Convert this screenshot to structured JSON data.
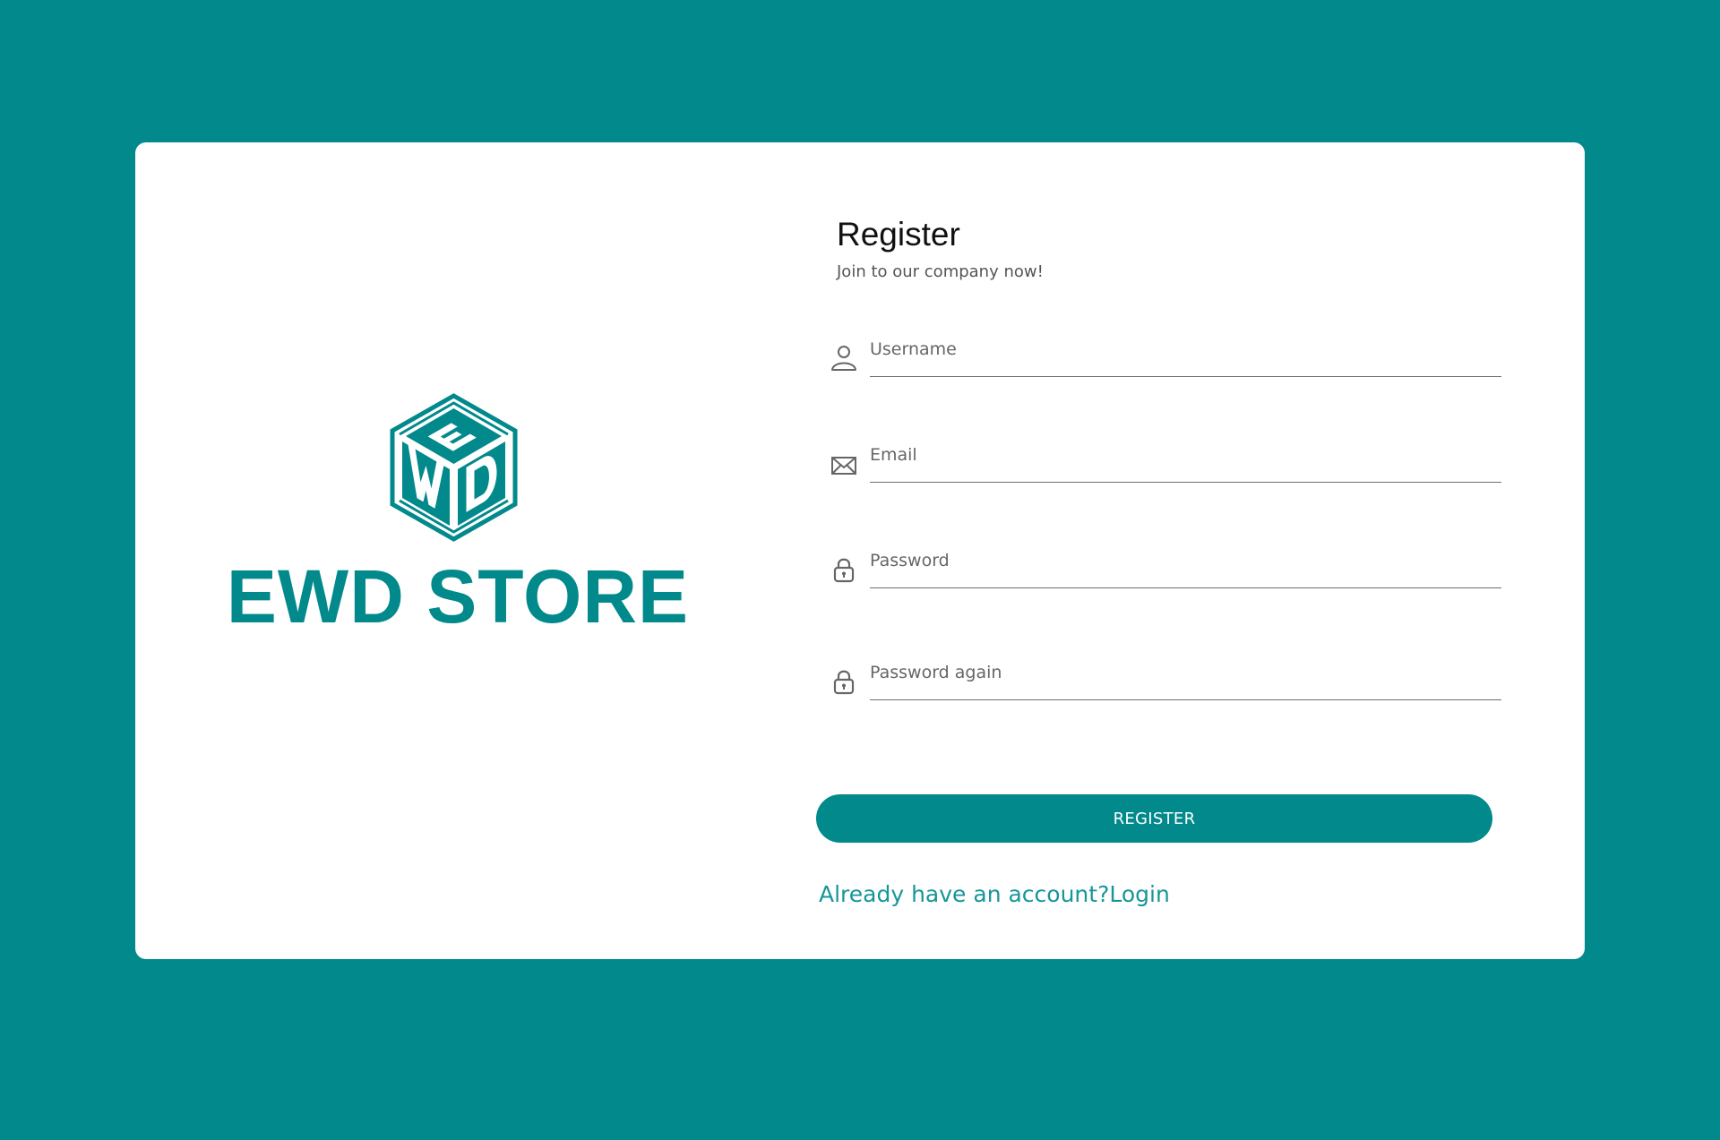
{
  "brand": {
    "name": "EWD STORE",
    "logo_letters": "EWD",
    "color": "#02898b"
  },
  "form": {
    "title": "Register",
    "subtitle": "Join to our company now!",
    "fields": {
      "username": {
        "placeholder": "Username",
        "value": "",
        "icon": "user-icon"
      },
      "email": {
        "placeholder": "Email",
        "value": "",
        "icon": "envelope-icon"
      },
      "password": {
        "placeholder": "Password",
        "value": "",
        "icon": "lock-icon"
      },
      "password_again": {
        "placeholder": "Password again",
        "value": "",
        "icon": "lock-icon"
      }
    },
    "submit_label": "REGISTER",
    "login_link": "Already have an account?Login"
  },
  "colors": {
    "background": "#02898b",
    "card": "#ffffff",
    "accent": "#02898b",
    "link": "#17969a"
  }
}
